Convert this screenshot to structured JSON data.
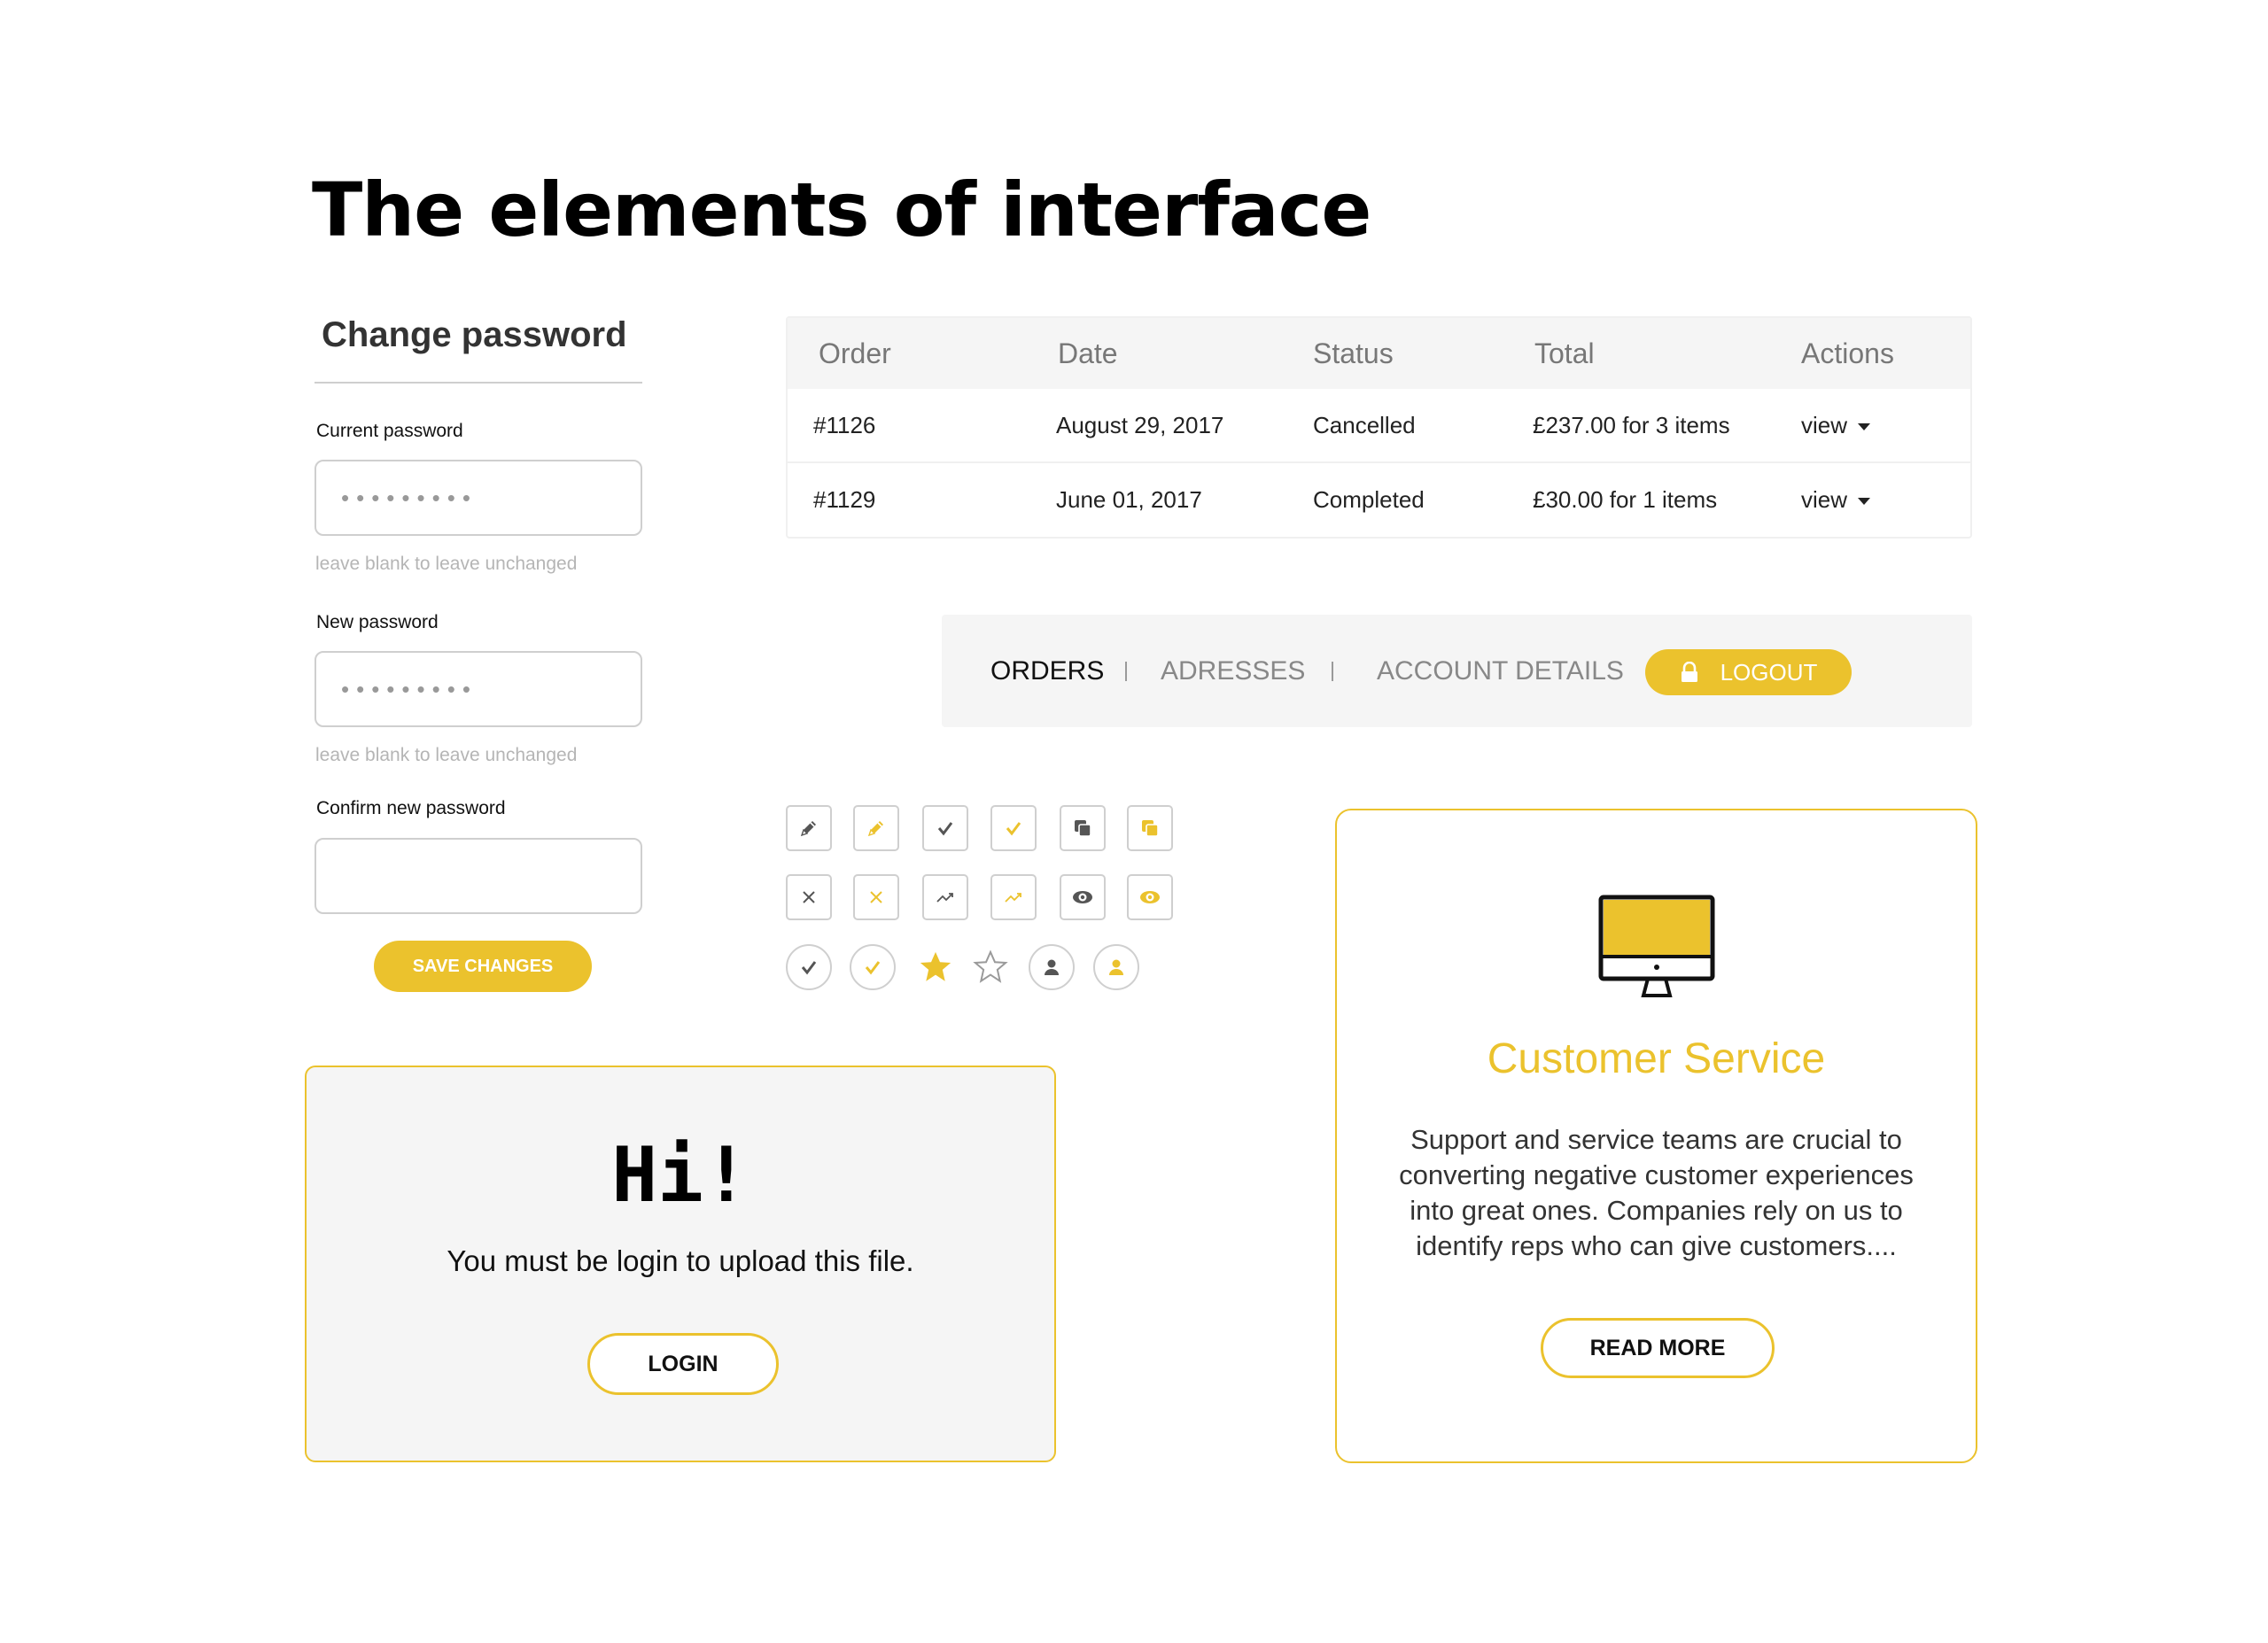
{
  "page": {
    "title": "The elements of interface"
  },
  "colors": {
    "accent": "#ebc22d",
    "muted_border": "#cfcfcf",
    "panel_bg": "#f5f5f5"
  },
  "change_password": {
    "title": "Change password",
    "current_label": "Current password",
    "current_value": "•••••••••",
    "current_hint": "leave blank to leave unchanged",
    "new_label": "New password",
    "new_value": "•••••••••",
    "new_hint": "leave blank to leave unchanged",
    "confirm_label": "Confirm new password",
    "confirm_value": "",
    "save_label": "Save changes"
  },
  "orders": {
    "headers": [
      "Order",
      "Date",
      "Status",
      "Total",
      "Actions"
    ],
    "rows": [
      {
        "order": "#1126",
        "date": "August 29, 2017",
        "status": "Cancelled",
        "total": "£237.00 for 3 items",
        "action": "view"
      },
      {
        "order": "#1129",
        "date": "June 01, 2017",
        "status": "Completed",
        "total": "£30.00 for 1 items",
        "action": "view"
      }
    ]
  },
  "account_nav": {
    "items": [
      "ORDERS",
      "ADRESSES",
      "ACCOUNT DETAILS"
    ],
    "active": "ORDERS",
    "logout_label": "LOGOUT"
  },
  "icons": [
    [
      "pencil-icon",
      "pencil-icon-active",
      "check-icon",
      "check-icon-active",
      "copy-icon",
      "copy-icon-active"
    ],
    [
      "close-icon",
      "close-icon-active",
      "trend-icon",
      "trend-icon-active",
      "eye-icon",
      "eye-icon-active"
    ],
    [
      "check-circle-icon",
      "check-circle-icon-active",
      "star-filled-icon",
      "star-outline-icon",
      "user-icon",
      "user-icon-active"
    ]
  ],
  "login_card": {
    "title": "Hi!",
    "message": "You must be login to upload this file.",
    "button_label": "LOGIN"
  },
  "customer_service": {
    "icon": "monitor-icon",
    "title": "Customer Service",
    "text": "Support and service teams are crucial to converting negative customer experiences into great ones. Companies rely on us to identify reps who can give customers....",
    "button_label": "READ MORE"
  }
}
